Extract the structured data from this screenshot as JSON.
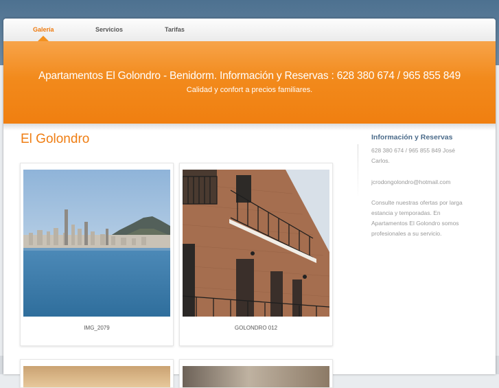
{
  "nav": {
    "items": [
      {
        "label": "Galería",
        "active": true
      },
      {
        "label": "Servicios",
        "active": false
      },
      {
        "label": "Tarifas",
        "active": false
      }
    ]
  },
  "banner": {
    "title": "Apartamentos El Golondro - Benidorm. Información y Reservas : 628 380 674 / 965 855 849",
    "subtitle": "Calidad y confort a precios familiares."
  },
  "main": {
    "title": "El Golondro",
    "gallery": [
      {
        "caption": "IMG_2079"
      },
      {
        "caption": "GOLONDRO 012"
      }
    ]
  },
  "sidebar": {
    "title": "Información y Reservas",
    "phone": "628 380 674 / 965 855 849 José Carlos.",
    "email": "jcrodongolondro@hotmail.com",
    "description": "Consulte nuestras ofertas por larga estancia y temporadas. En Apartamentos El Golondro somos profesionales a su servicio."
  },
  "colors": {
    "accent": "#ee7a0e",
    "banner": "#f28a1c",
    "sidebar_title": "#4b6b8a",
    "header_band": "#5b7b98"
  }
}
